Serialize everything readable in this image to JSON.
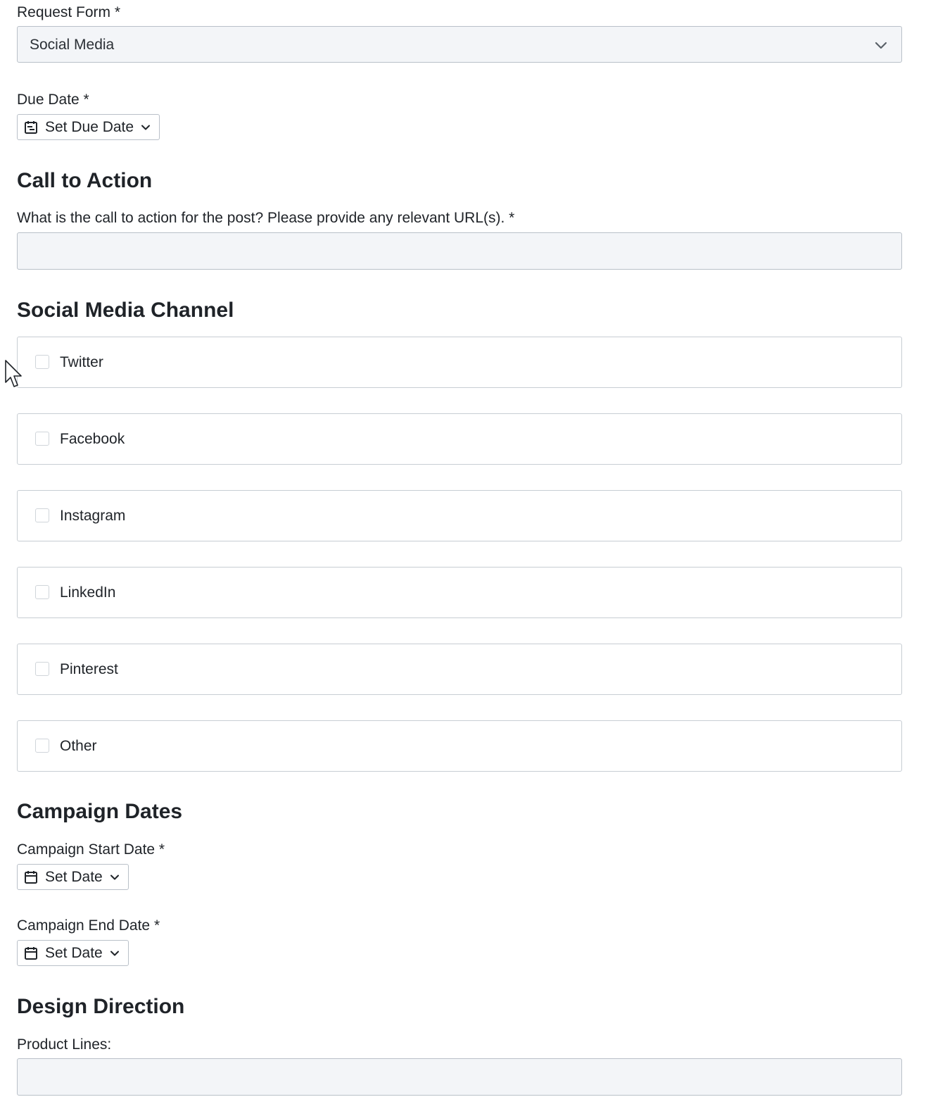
{
  "request_form": {
    "label": "Request Form *",
    "selected": "Social Media"
  },
  "due_date": {
    "label": "Due Date *",
    "button": "Set Due Date"
  },
  "call_to_action": {
    "heading": "Call to Action",
    "question": "What is the call to action for the post? Please provide any relevant URL(s). *",
    "value": ""
  },
  "social_media_channel": {
    "heading": "Social Media Channel",
    "options": [
      {
        "label": "Twitter",
        "checked": false
      },
      {
        "label": "Facebook",
        "checked": false
      },
      {
        "label": "Instagram",
        "checked": false
      },
      {
        "label": "LinkedIn",
        "checked": false
      },
      {
        "label": "Pinterest",
        "checked": false
      },
      {
        "label": "Other",
        "checked": false
      }
    ]
  },
  "campaign_dates": {
    "heading": "Campaign Dates",
    "start": {
      "label": "Campaign Start Date *",
      "button": "Set Date"
    },
    "end": {
      "label": "Campaign End Date *",
      "button": "Set Date"
    }
  },
  "design_direction": {
    "heading": "Design Direction",
    "product_lines_label": "Product Lines:",
    "product_lines_value": ""
  },
  "icons": {
    "select_chevron": "chevron-down-icon",
    "due_date": "calendar-clock-icon",
    "set_date": "calendar-icon",
    "dropdown": "chevron-down-icon"
  },
  "colors": {
    "input_background": "#f3f5f8",
    "border": "#b9c0c8",
    "text": "#1f2328"
  }
}
